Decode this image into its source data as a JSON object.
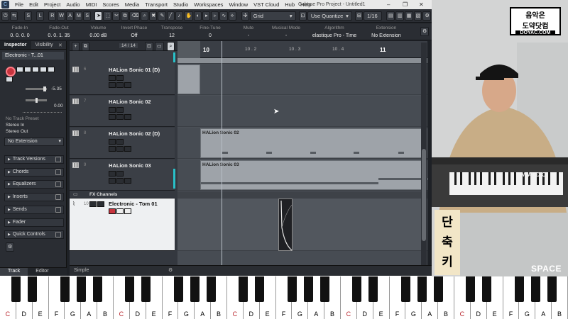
{
  "window": {
    "title": "Cubase Pro Project - Untitled1",
    "menu": [
      "File",
      "Edit",
      "Project",
      "Audio",
      "MIDI",
      "Scores",
      "Media",
      "Transport",
      "Studio",
      "Workspaces",
      "Window",
      "VST Cloud",
      "Hub",
      "Help"
    ]
  },
  "toolbar": {
    "mode_buttons": [
      "S",
      "L",
      "R",
      "W",
      "A",
      "M",
      "S"
    ],
    "snap_type": "Grid",
    "quantize_type": "Use Quantize",
    "quantize_value": "1/16"
  },
  "infoline": [
    {
      "label": "Fade-In",
      "value": "0.  0.  0.  0"
    },
    {
      "label": "Fade-Out",
      "value": "0.  0.  1. 35"
    },
    {
      "label": "Volume",
      "value": "0.00          dB"
    },
    {
      "label": "Invert Phase",
      "value": "Off"
    },
    {
      "label": "Transpose",
      "value": "12"
    },
    {
      "label": "Fine-Tune",
      "value": "0"
    },
    {
      "label": "Mute",
      "value": "-"
    },
    {
      "label": "Musical Mode",
      "value": "-"
    },
    {
      "label": "Algorithm",
      "value": "elastique Pro - Time"
    },
    {
      "label": "Extension",
      "value": "No Extension"
    }
  ],
  "inspector": {
    "tabs": [
      "Inspector",
      "Visibility"
    ],
    "track_name": "Electronic - T...01",
    "volume_value": "-5.35",
    "pan_value": "0.00",
    "preset": "No Track Preset",
    "input": "Stereo In",
    "output": "Stereo Out",
    "extension": "No Extension",
    "sections": [
      "Track Versions",
      "Chords",
      "Equalizers",
      "Inserts",
      "Sends",
      "Fader",
      "Quick Controls"
    ],
    "bottom_tabs": [
      "Track",
      "Editor"
    ]
  },
  "tracklist": {
    "counter": "14 / 14",
    "tracks": [
      {
        "num": "6",
        "name": "HALion Sonic 01 (D)"
      },
      {
        "num": "7",
        "name": "HALion Sonic 02"
      },
      {
        "num": "8",
        "name": "HALion Sonic 02 (D)"
      },
      {
        "num": "9",
        "name": "HALion Sonic 03"
      }
    ],
    "folder_name": "FX Channels",
    "selected_track": {
      "num": "10",
      "name": "Electronic - Tom 01"
    },
    "status_text": "Simple"
  },
  "ruler": {
    "labels": [
      "10",
      "10 . 2",
      "10 . 3",
      "10 . 4",
      "11"
    ]
  },
  "parts": [
    {
      "name": "HALion Sonic 02"
    },
    {
      "name": "HALion Sonic 03"
    }
  ],
  "overlay": {
    "logo_line1": "음악은",
    "logo_line2": "도약닷컴",
    "logo_url": "DOYAC.COM",
    "shortcut_label": "단축키",
    "key_pressed": "SPACE",
    "keyboard_brand": "M-AUDIO"
  },
  "piano_labels": [
    "C",
    "D",
    "E",
    "F",
    "G",
    "A",
    "B",
    "C",
    "D",
    "E",
    "F",
    "G",
    "A",
    "B",
    "C",
    "D",
    "E",
    "F",
    "G",
    "A",
    "B",
    "C",
    "D",
    "E",
    "F",
    "G",
    "A",
    "B",
    "C",
    "D",
    "E",
    "F",
    "G",
    "A",
    "B"
  ],
  "colors": {
    "record": "#c8343e",
    "accent_cyan": "#29c0c8",
    "overlay_box": "#f2e6c7"
  }
}
